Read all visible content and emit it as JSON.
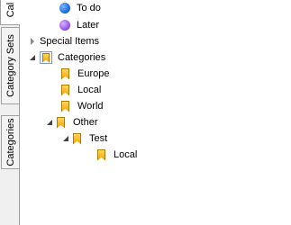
{
  "tabs": [
    {
      "label": "Cal"
    },
    {
      "label": "Category Sets"
    },
    {
      "label": "Categories"
    }
  ],
  "tree": {
    "todo_label": "To do",
    "later_label": "Later",
    "special_items_label": "Special Items",
    "categories_label": "Categories",
    "europe_label": "Europe",
    "local_label": "Local",
    "world_label": "World",
    "other_label": "Other",
    "test_label": "Test",
    "test_local_label": "Local"
  },
  "colors": {
    "todo": "#1c6de0",
    "later": "#9a57e8",
    "bookmark": "#f2a300"
  }
}
